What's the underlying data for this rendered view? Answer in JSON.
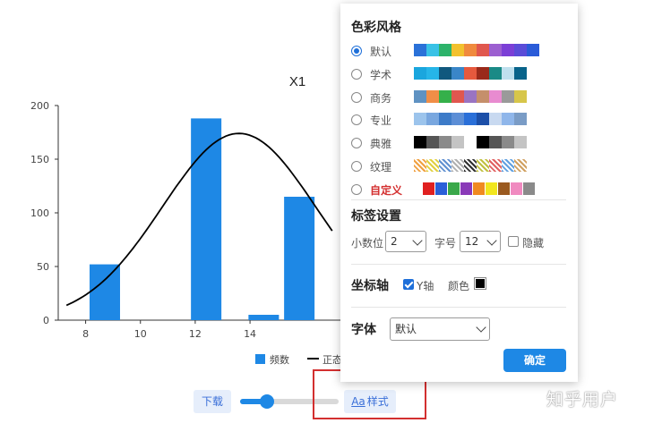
{
  "chart_data": {
    "type": "bar",
    "title": "X1",
    "x": [
      8.7,
      12.4,
      14.5,
      15.8
    ],
    "values": [
      52,
      188,
      5,
      115
    ],
    "curve": {
      "mean": 13.6,
      "sd": 2.8,
      "scale": 174
    },
    "xlim": [
      7,
      17.3
    ],
    "ylim": [
      0,
      200
    ],
    "xticks": [
      "8",
      "10",
      "12",
      "14"
    ],
    "yticks": [
      "0",
      "50",
      "100",
      "150",
      "200"
    ],
    "bar_color": "#1e88e5",
    "series": [
      {
        "name": "频数"
      },
      {
        "name": "正态"
      }
    ]
  },
  "controls": {
    "download_label": "下载",
    "style_icon": "Aa",
    "style_label": "样式",
    "slider_value": 0.27
  },
  "watermark": "知乎用户",
  "panel": {
    "color_style": {
      "title": "色彩风格",
      "options": [
        {
          "label": "默认",
          "selected": true,
          "colors": [
            "#2a71d8",
            "#39c2e6",
            "#2db36a",
            "#f2c12e",
            "#f08a3e",
            "#e0574e",
            "#9c5fd0",
            "#7b3fd6",
            "#5a4cd8",
            "#2a5bd8"
          ]
        },
        {
          "label": "学术",
          "selected": false,
          "colors": [
            "#1aa6de",
            "#26b5e8",
            "#10587e",
            "#3a86c8",
            "#e6593d",
            "#9a2a1a",
            "#1a8a86",
            "#bfe0ee",
            "#08638a"
          ]
        },
        {
          "label": "商务",
          "selected": false,
          "colors": [
            "#5f92c2",
            "#f08e47",
            "#35b04a",
            "#e0574f",
            "#9a74c2",
            "#c58f6b",
            "#e88bd0",
            "#9a9a9a",
            "#d7c64a"
          ]
        },
        {
          "label": "专业",
          "selected": false,
          "colors": [
            "#9cc4ec",
            "#79a7df",
            "#3d7bc8",
            "#5c8ed6",
            "#2a6fd8",
            "#1c4fa8",
            "#c8d9f0",
            "#8fb6ea",
            "#7a9cc6"
          ]
        },
        {
          "label": "典雅",
          "selected": false,
          "colors": [
            "#000000",
            "#555555",
            "#8a8a8a",
            "#c4c4c4",
            "#ffffff",
            "#000000",
            "#555555",
            "#8a8a8a",
            "#c4c4c4"
          ]
        },
        {
          "label": "纹理",
          "selected": false,
          "colors": [
            "#f0a040",
            "#e0d040",
            "#6090d0",
            "#b0b0b0",
            "#303030",
            "#c0c040",
            "#e06060",
            "#60a0e0",
            "#d0a060"
          ]
        },
        {
          "label": "自定义",
          "selected": false,
          "custom": true,
          "colors": [
            "#e02020",
            "#2a5fd8",
            "#3aa84a",
            "#8a3ab8",
            "#f08a20",
            "#f2e61e",
            "#9a5a20",
            "#f08ac0",
            "#8a8a8a"
          ]
        }
      ]
    },
    "label_settings": {
      "title": "标签设置",
      "decimals_label": "小数位",
      "decimals_value": "2",
      "fontsize_label": "字号",
      "fontsize_value": "12",
      "hide_label": "隐藏",
      "hide_checked": false
    },
    "axis": {
      "title": "坐标轴",
      "y_label": "Y轴",
      "y_checked": true,
      "color_label": "颜色",
      "color": "#000000"
    },
    "font": {
      "title": "字体",
      "value": "默认"
    },
    "ok_label": "确定"
  }
}
